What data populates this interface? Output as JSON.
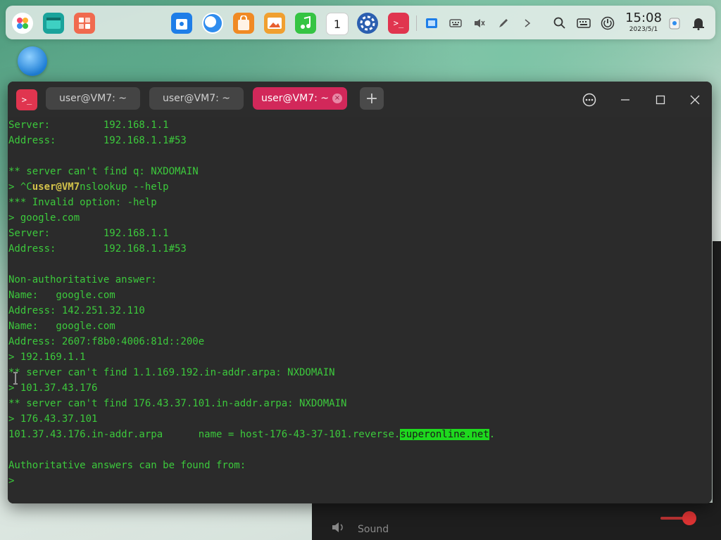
{
  "dock": {
    "apps": [
      {
        "name": "launcher-grid",
        "color": "#ffffff"
      },
      {
        "name": "file-manager",
        "color": "#1aa39b"
      },
      {
        "name": "app-store",
        "color": "#f06a4f"
      },
      {
        "name": "deepin-store",
        "color": "#1e7ee8"
      },
      {
        "name": "browser",
        "color": "#2f8dee"
      },
      {
        "name": "shop",
        "color": "#f08a24"
      },
      {
        "name": "image-viewer",
        "color": "#f0a030"
      },
      {
        "name": "music",
        "color": "#35c443"
      },
      {
        "name": "calendar",
        "color": "#ffffff"
      },
      {
        "name": "settings",
        "color": "#2b5fb0"
      },
      {
        "name": "terminal",
        "color": "#e0354f"
      }
    ],
    "calendar_day": "1",
    "tray": [
      "screenshot-icon",
      "keyboard-icon",
      "volume-muted-icon",
      "pen-icon",
      "chevron-right-icon",
      "search-icon",
      "keyboard-layout-icon",
      "power-icon"
    ],
    "time": "15:08",
    "date": "2023/5/1"
  },
  "window": {
    "app_icon": ">_",
    "tabs": [
      {
        "label": "user@VM7: ~",
        "active": false
      },
      {
        "label": "user@VM7: ~",
        "active": false
      },
      {
        "label": "user@VM7: ~",
        "active": true
      }
    ],
    "add_tab": "+",
    "tab_close": "×",
    "menu_icon": "⋯",
    "minimize": "—",
    "maximize": "☐",
    "close": "✕"
  },
  "terminal": {
    "lines": [
      "Server:         192.168.1.1",
      "Address:        192.168.1.1#53",
      "",
      "** server can't find q: NXDOMAIN",
      "> ^C",
      "*** Invalid option: -help",
      "> google.com",
      "Server:         192.168.1.1",
      "Address:        192.168.1.1#53",
      "",
      "Non-authoritative answer:",
      "Name:   google.com",
      "Address: 142.251.32.110",
      "Name:   google.com",
      "Address: 2607:f8b0:4006:81d::200e",
      "> 192.169.1.1",
      "** server can't find 1.1.169.192.in-addr.arpa: NXDOMAIN",
      "> 101.37.43.176",
      "** server can't find 176.43.37.101.in-addr.arpa: NXDOMAIN",
      "> 176.43.37.101",
      "101.37.43.176.in-addr.arpa      name = host-176-43-37-101.reverse.",
      "",
      "Authoritative answers can be found from:",
      ">"
    ],
    "line4_user": "user@VM7",
    "line4_rest": "nslookup --help",
    "line20_highlight": "superonline.net",
    "line20_tail": "."
  },
  "sound_panel": {
    "label": "Sound"
  }
}
